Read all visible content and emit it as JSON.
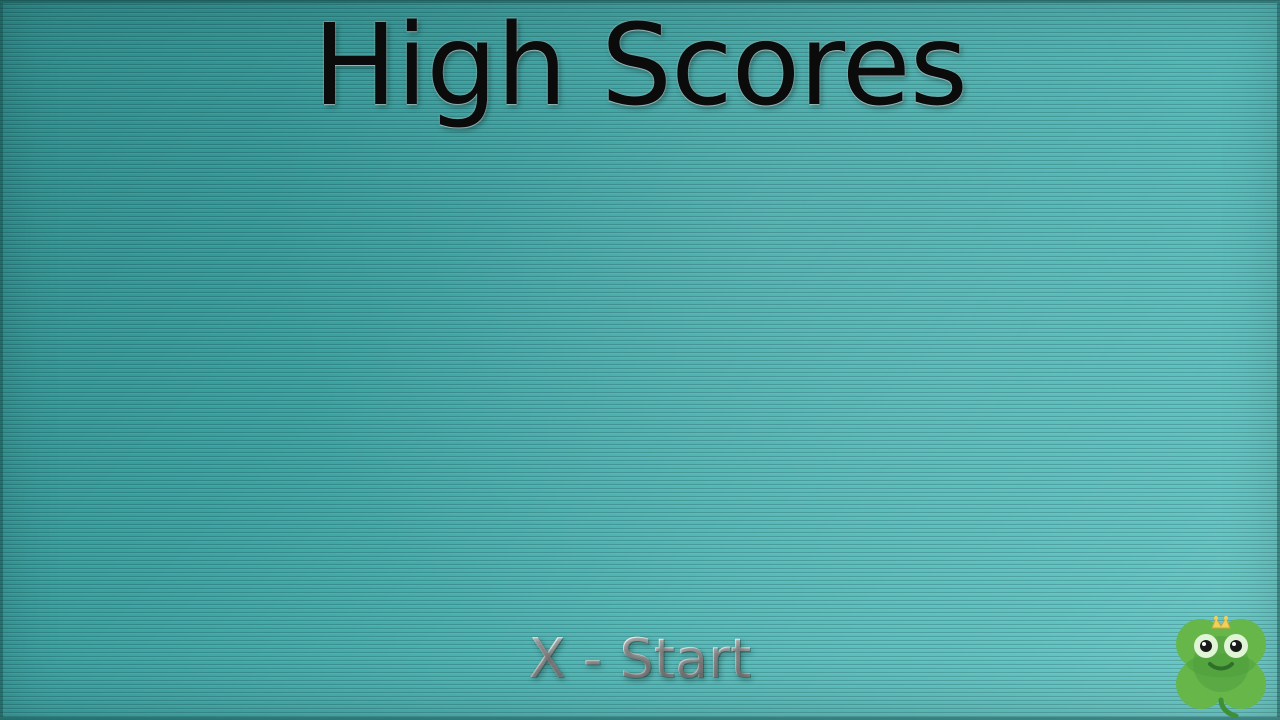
{
  "screen": {
    "title": "High Scores",
    "start_hint": "X - Start"
  },
  "mascot": {
    "icon": "clover-frog-mascot",
    "colors": {
      "leaf": "#67b64a",
      "leaf_dark": "#3f8f33",
      "crown": "#f2d05a",
      "eye_white": "#dff5d6",
      "eye_black": "#1a1a1a"
    }
  },
  "colors": {
    "background_start": "#2e8b8b",
    "background_end": "#6ccbc9",
    "title_text": "#0b0b0b",
    "hint_text": "#d8d8d8"
  }
}
